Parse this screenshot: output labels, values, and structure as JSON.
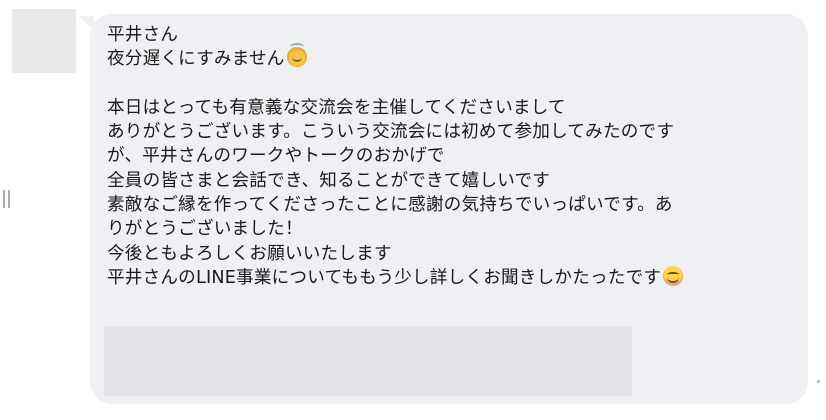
{
  "message": {
    "greeting": "平井さん",
    "line2": "夜分遅くにすみません",
    "line2_emoji": "sweat-smile-emoji",
    "body_lines": [
      "本日はとっても有意義な交流会を主催してくださいまして",
      "ありがとうございます。こういう交流会には初めて参加してみたのです",
      "が、平井さんのワークやトークのおかげで",
      "全員の皆さまと会話でき、知ることができて嬉しいです",
      "素敵なご縁を作ってくださったことに感謝の気持ちでいっぱいです。あ",
      "りがとうございました！",
      "今後ともよろしくお願いいたします"
    ],
    "last_line": "平井さんのLINE事業についてももう少し詳しくお聞きしかたったです",
    "last_line_emoji": "smiling-face-emoji"
  },
  "colors": {
    "bubble": "#eef0f3",
    "text": "#1a1a1a",
    "avatar_placeholder": "#e9e9eb",
    "redacted_block": "#e3e4e7"
  }
}
